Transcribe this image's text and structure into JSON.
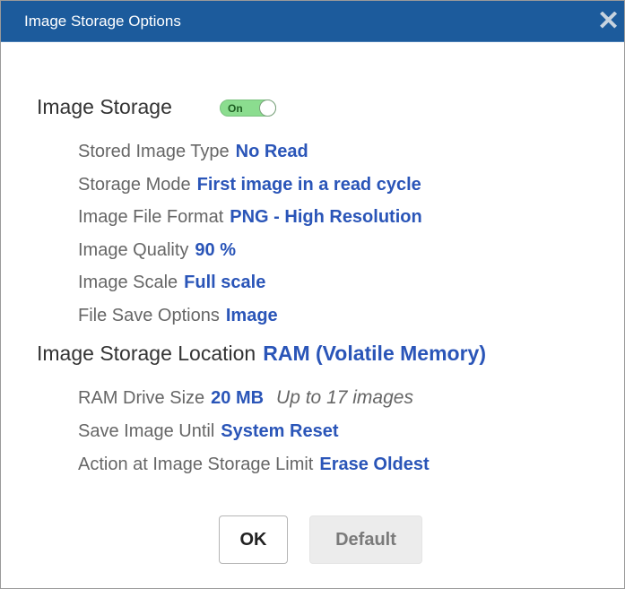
{
  "dialog": {
    "title": "Image Storage Options",
    "close_glyph": "✕"
  },
  "image_storage": {
    "label": "Image Storage",
    "toggle": {
      "state": "On",
      "on": true,
      "color": "#8bdd8f"
    },
    "settings": [
      {
        "label": "Stored Image Type",
        "value": "No Read"
      },
      {
        "label": "Storage Mode",
        "value": "First image in a read cycle"
      },
      {
        "label": "Image File Format",
        "value": "PNG - High Resolution"
      },
      {
        "label": "Image Quality",
        "value": "90 %"
      },
      {
        "label": "Image Scale",
        "value": "Full scale"
      },
      {
        "label": "File Save Options",
        "value": "Image"
      }
    ]
  },
  "storage_location": {
    "label": "Image Storage Location",
    "value": "RAM (Volatile Memory)",
    "settings": [
      {
        "label": "RAM Drive Size",
        "value": "20 MB",
        "note": "Up to 17 images"
      },
      {
        "label": "Save Image Until",
        "value": "System Reset"
      },
      {
        "label": "Action at Image Storage Limit",
        "value": "Erase Oldest"
      }
    ]
  },
  "buttons": {
    "ok": "OK",
    "default": "Default"
  },
  "colors": {
    "titlebar": "#1c5b9c",
    "value_text": "#2a55b8",
    "label_text": "#666666"
  }
}
